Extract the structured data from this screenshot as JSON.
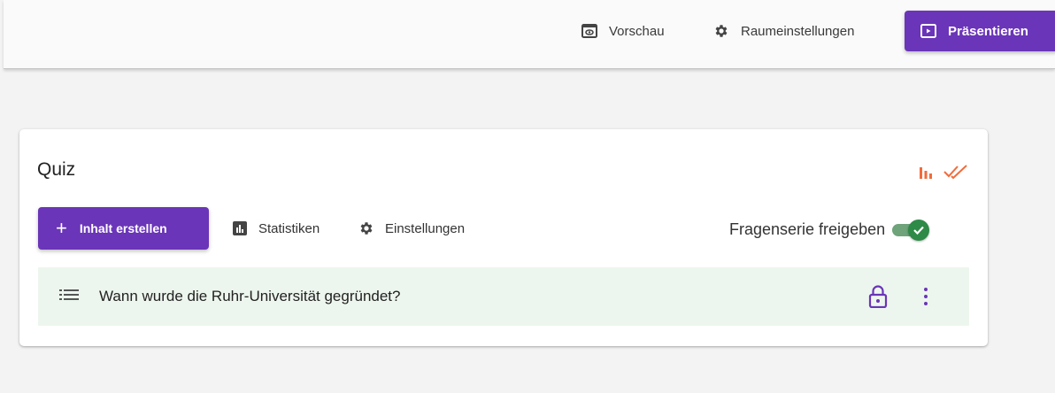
{
  "header": {
    "preview_label": "Vorschau",
    "room_settings_label": "Raumeinstellungen",
    "present_label": "Präsentieren"
  },
  "card": {
    "title": "Quiz",
    "create_label": "Inhalt erstellen",
    "create_icon": "+",
    "statistics_label": "Statistiken",
    "settings_label": "Einstellungen",
    "publish_label": "Fragenserie freigeben",
    "publish_enabled": true,
    "status_icons": [
      "bar-chart-icon",
      "double-check-icon"
    ],
    "status_color": "#f26b3a"
  },
  "questions": [
    {
      "text": "Wann wurde die Ruhr-Universität gegründet?",
      "locked": true
    }
  ],
  "colors": {
    "accent": "#6a35b8",
    "toggle_on": "#2e8a47",
    "row_background": "#edf6ee"
  }
}
